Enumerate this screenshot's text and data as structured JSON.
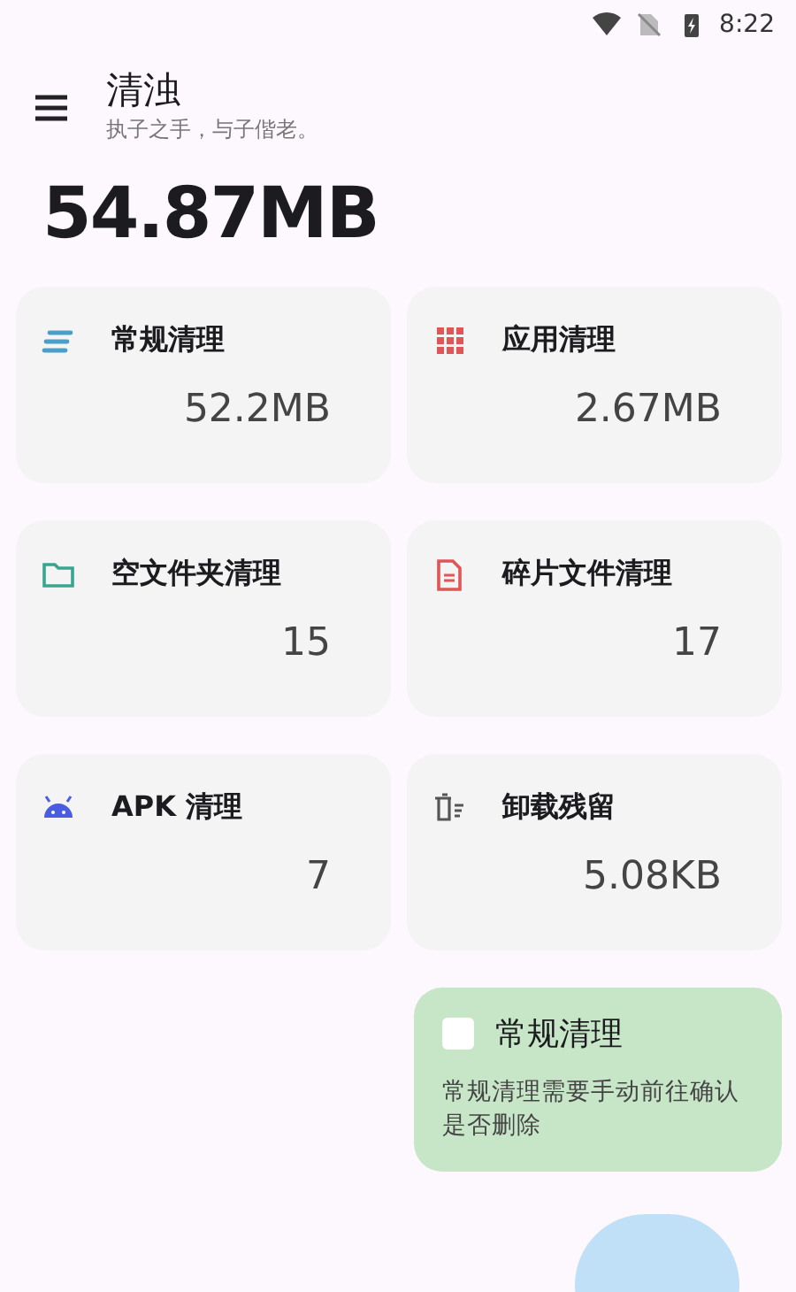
{
  "status_bar": {
    "time": "8:22"
  },
  "header": {
    "title": "清浊",
    "subtitle": "执子之手，与子偕老。"
  },
  "total": "54.87MB",
  "cards": [
    {
      "kind": "lines",
      "label": "常规清理",
      "value": "52.2MB"
    },
    {
      "kind": "grid",
      "label": "应用清理",
      "value": "2.67MB"
    },
    {
      "kind": "folder",
      "label": "空文件夹清理",
      "value": "15"
    },
    {
      "kind": "document",
      "label": "碎片文件清理",
      "value": "17"
    },
    {
      "kind": "android",
      "label": "APK 清理",
      "value": "7"
    },
    {
      "kind": "trash",
      "label": "卸载残留",
      "value": "5.08KB"
    }
  ],
  "notice": {
    "title": "常规清理",
    "body": "常规清理需要手动前往确认是否删除"
  }
}
